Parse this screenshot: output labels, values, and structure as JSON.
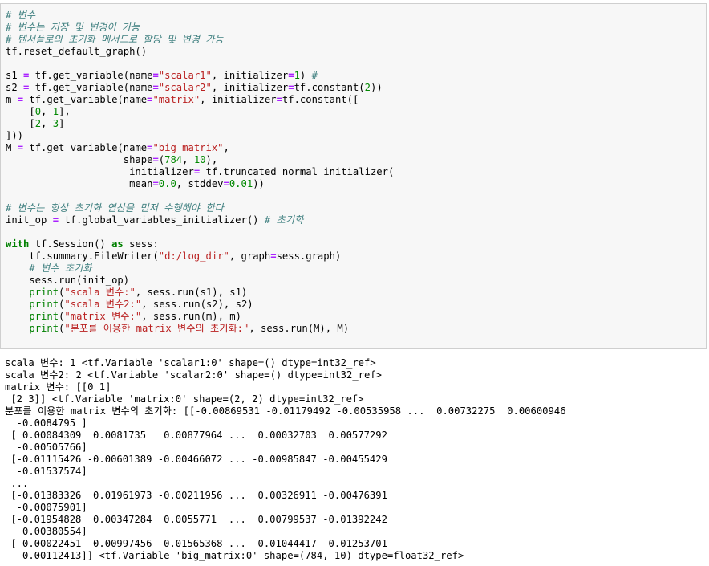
{
  "code_cell": {
    "lines": [
      [
        {
          "t": "# 변수",
          "c": "c"
        }
      ],
      [
        {
          "t": "# 변수는 저장 및 변경이 가능",
          "c": "c"
        }
      ],
      [
        {
          "t": "# 텐서플로의 초기화 메서드로 할당 및 변경 가능",
          "c": "c"
        }
      ],
      [
        {
          "t": "tf.reset_default_graph()",
          "c": ""
        }
      ],
      [],
      [
        {
          "t": "s1 ",
          "c": ""
        },
        {
          "t": "=",
          "c": "o"
        },
        {
          "t": " tf.get_variable(name",
          "c": ""
        },
        {
          "t": "=",
          "c": "o"
        },
        {
          "t": "\"scalar1\"",
          "c": "s"
        },
        {
          "t": ", initializer",
          "c": ""
        },
        {
          "t": "=",
          "c": "o"
        },
        {
          "t": "1",
          "c": "n"
        },
        {
          "t": ") ",
          "c": ""
        },
        {
          "t": "#",
          "c": "c"
        }
      ],
      [
        {
          "t": "s2 ",
          "c": ""
        },
        {
          "t": "=",
          "c": "o"
        },
        {
          "t": " tf.get_variable(name",
          "c": ""
        },
        {
          "t": "=",
          "c": "o"
        },
        {
          "t": "\"scalar2\"",
          "c": "s"
        },
        {
          "t": ", initializer",
          "c": ""
        },
        {
          "t": "=",
          "c": "o"
        },
        {
          "t": "tf.constant(",
          "c": ""
        },
        {
          "t": "2",
          "c": "n"
        },
        {
          "t": "))",
          "c": ""
        }
      ],
      [
        {
          "t": "m ",
          "c": ""
        },
        {
          "t": "=",
          "c": "o"
        },
        {
          "t": " tf.get_variable(name",
          "c": ""
        },
        {
          "t": "=",
          "c": "o"
        },
        {
          "t": "\"matrix\"",
          "c": "s"
        },
        {
          "t": ", initializer",
          "c": ""
        },
        {
          "t": "=",
          "c": "o"
        },
        {
          "t": "tf.constant([",
          "c": ""
        }
      ],
      [
        {
          "t": "    [",
          "c": ""
        },
        {
          "t": "0",
          "c": "n"
        },
        {
          "t": ", ",
          "c": ""
        },
        {
          "t": "1",
          "c": "n"
        },
        {
          "t": "],",
          "c": ""
        }
      ],
      [
        {
          "t": "    [",
          "c": ""
        },
        {
          "t": "2",
          "c": "n"
        },
        {
          "t": ", ",
          "c": ""
        },
        {
          "t": "3",
          "c": "n"
        },
        {
          "t": "]",
          "c": ""
        }
      ],
      [
        {
          "t": "]))",
          "c": ""
        }
      ],
      [
        {
          "t": "M ",
          "c": ""
        },
        {
          "t": "=",
          "c": "o"
        },
        {
          "t": " tf.get_variable(name",
          "c": ""
        },
        {
          "t": "=",
          "c": "o"
        },
        {
          "t": "\"big_matrix\"",
          "c": "s"
        },
        {
          "t": ",",
          "c": ""
        }
      ],
      [
        {
          "t": "                    shape",
          "c": ""
        },
        {
          "t": "=",
          "c": "o"
        },
        {
          "t": "(",
          "c": ""
        },
        {
          "t": "784",
          "c": "n"
        },
        {
          "t": ", ",
          "c": ""
        },
        {
          "t": "10",
          "c": "n"
        },
        {
          "t": "),",
          "c": ""
        }
      ],
      [
        {
          "t": "                     initializer",
          "c": ""
        },
        {
          "t": "=",
          "c": "o"
        },
        {
          "t": " tf.truncated_normal_initializer(",
          "c": ""
        }
      ],
      [
        {
          "t": "                     mean",
          "c": ""
        },
        {
          "t": "=",
          "c": "o"
        },
        {
          "t": "0.0",
          "c": "n"
        },
        {
          "t": ", stddev",
          "c": ""
        },
        {
          "t": "=",
          "c": "o"
        },
        {
          "t": "0.01",
          "c": "n"
        },
        {
          "t": "))",
          "c": ""
        }
      ],
      [],
      [
        {
          "t": "# 변수는 항상 초기화 연산을 먼저 수행해야 한다",
          "c": "c"
        }
      ],
      [
        {
          "t": "init_op ",
          "c": ""
        },
        {
          "t": "=",
          "c": "o"
        },
        {
          "t": " tf.global_variables_initializer() ",
          "c": ""
        },
        {
          "t": "# 초기화",
          "c": "c"
        }
      ],
      [],
      [
        {
          "t": "with",
          "c": "k"
        },
        {
          "t": " tf.Session() ",
          "c": ""
        },
        {
          "t": "as",
          "c": "k"
        },
        {
          "t": " sess:",
          "c": ""
        }
      ],
      [
        {
          "t": "    tf.summary.FileWriter(",
          "c": ""
        },
        {
          "t": "\"d:/log_dir\"",
          "c": "s"
        },
        {
          "t": ", graph",
          "c": ""
        },
        {
          "t": "=",
          "c": "o"
        },
        {
          "t": "sess.graph)",
          "c": ""
        }
      ],
      [
        {
          "t": "    ",
          "c": ""
        },
        {
          "t": "# 변수 초기화",
          "c": "c"
        }
      ],
      [
        {
          "t": "    sess.run(init_op)",
          "c": ""
        }
      ],
      [
        {
          "t": "    ",
          "c": ""
        },
        {
          "t": "print",
          "c": "b"
        },
        {
          "t": "(",
          "c": ""
        },
        {
          "t": "\"scala 변수:\"",
          "c": "s"
        },
        {
          "t": ", sess.run(s1), s1)",
          "c": ""
        }
      ],
      [
        {
          "t": "    ",
          "c": ""
        },
        {
          "t": "print",
          "c": "b"
        },
        {
          "t": "(",
          "c": ""
        },
        {
          "t": "\"scala 변수2:\"",
          "c": "s"
        },
        {
          "t": ", sess.run(s2), s2)",
          "c": ""
        }
      ],
      [
        {
          "t": "    ",
          "c": ""
        },
        {
          "t": "print",
          "c": "b"
        },
        {
          "t": "(",
          "c": ""
        },
        {
          "t": "\"matrix 변수:\"",
          "c": "s"
        },
        {
          "t": ", sess.run(m), m)",
          "c": ""
        }
      ],
      [
        {
          "t": "    ",
          "c": ""
        },
        {
          "t": "print",
          "c": "b"
        },
        {
          "t": "(",
          "c": ""
        },
        {
          "t": "\"분포를 이용한 matrix 변수의 초기화:\"",
          "c": "s"
        },
        {
          "t": ", sess.run(M), M)",
          "c": ""
        }
      ]
    ]
  },
  "output_cell": {
    "lines": [
      "scala 변수: 1 <tf.Variable 'scalar1:0' shape=() dtype=int32_ref>",
      "scala 변수2: 2 <tf.Variable 'scalar2:0' shape=() dtype=int32_ref>",
      "matrix 변수: [[0 1]",
      " [2 3]] <tf.Variable 'matrix:0' shape=(2, 2) dtype=int32_ref>",
      "분포를 이용한 matrix 변수의 초기화: [[-0.00869531 -0.01179492 -0.00535958 ...  0.00732275  0.00600946",
      "  -0.0084795 ]",
      " [ 0.00084309  0.0081735   0.00877964 ...  0.00032703  0.00577292",
      "  -0.00505766]",
      " [-0.01115426 -0.00601389 -0.00466072 ... -0.00985847 -0.00455429",
      "  -0.01537574]",
      " ...",
      " [-0.01383326  0.01961973 -0.00211956 ...  0.00326911 -0.00476391",
      "  -0.00075901]",
      " [-0.01954828  0.00347284  0.0055771  ...  0.00799537 -0.01392242",
      "   0.00380554]",
      " [-0.00022451 -0.00997456 -0.01565368 ...  0.01044417  0.01253701",
      "   0.00112413]] <tf.Variable 'big_matrix:0' shape=(784, 10) dtype=float32_ref>"
    ]
  }
}
